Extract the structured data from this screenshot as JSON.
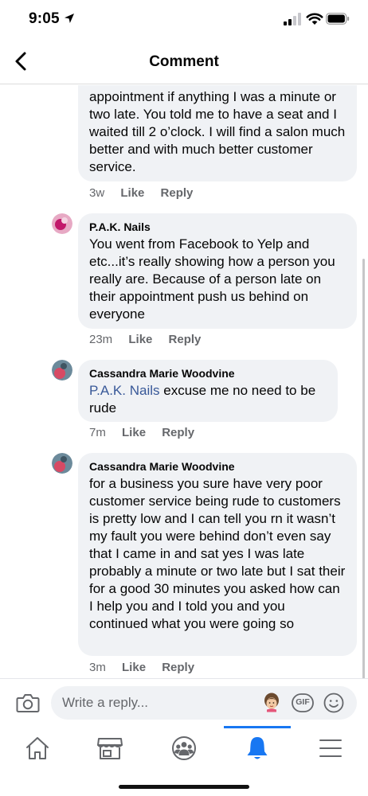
{
  "status_bar": {
    "time": "9:05"
  },
  "header": {
    "title": "Comment"
  },
  "comments": [
    {
      "author": "",
      "text": "appointment if anything I was a minute or two late. You told me to have a seat and I waited till 2 o’clock. I will find a salon much better and with much better customer service.",
      "time": "3w",
      "like_label": "Like",
      "reply_label": "Reply"
    },
    {
      "author": "P.A.K. Nails",
      "text": "You went from Facebook to Yelp and etc...it’s really showing how a person you really are. Because of a person late on their appointment push us behind on everyone",
      "time": "23m",
      "like_label": "Like",
      "reply_label": "Reply"
    },
    {
      "author": "Cassandra Marie Woodvine",
      "mention": "P.A.K. Nails",
      "text": " excuse me no need to be rude",
      "time": "7m",
      "like_label": "Like",
      "reply_label": "Reply"
    },
    {
      "author": "Cassandra Marie Woodvine",
      "text": "for a business you sure have very poor customer service being rude  to customers is pretty low and I can tell you rn it wasn’t my fault you were behind don’t even say that I came in and sat yes I was late probably a minute or two late but I sat their for a good 30 minutes you asked how can I help you and I told you and you continued what you were going so",
      "time": "3m",
      "like_label": "Like",
      "reply_label": "Reply"
    }
  ],
  "composer": {
    "placeholder": "Write a reply...",
    "gif_label": "GIF",
    "icons": [
      "camera-icon",
      "avatar-sticker-icon",
      "gif-icon",
      "emoji-icon"
    ]
  },
  "tabs": [
    {
      "name": "home",
      "icon": "home-icon",
      "active": false
    },
    {
      "name": "marketplace",
      "icon": "store-icon",
      "active": false
    },
    {
      "name": "groups",
      "icon": "groups-icon",
      "active": false
    },
    {
      "name": "notifications",
      "icon": "bell-icon",
      "active": true
    },
    {
      "name": "menu",
      "icon": "menu-icon",
      "active": false
    }
  ],
  "colors": {
    "accent": "#1877f2",
    "mention": "#385898",
    "bubble": "#f0f2f5",
    "meta_text": "#65676b"
  }
}
